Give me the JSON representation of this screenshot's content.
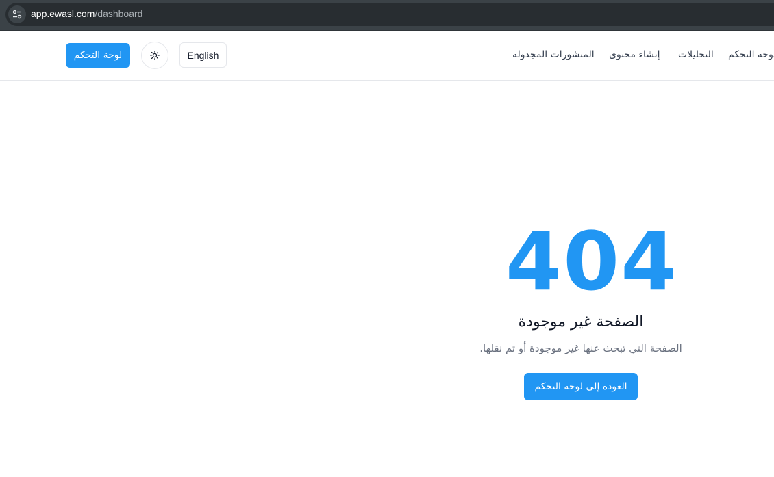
{
  "browser": {
    "url_domain": "app.ewasl.com",
    "url_path": "/dashboard",
    "site_info_icon": "tune-icon"
  },
  "header": {
    "primary_button": "لوحة التحكم",
    "theme_toggle_icon": "sun-icon",
    "language_button": "English",
    "nav": [
      {
        "label": "لوحة التحكم"
      },
      {
        "label": "التحليلات"
      },
      {
        "label": "إنشاء محتوى"
      },
      {
        "label": "المنشورات المجدولة"
      }
    ]
  },
  "main": {
    "code": "404",
    "title": "الصفحة غير موجودة",
    "description": "الصفحة التي تبحث عنها غير موجودة أو تم نقلها.",
    "back_button": "العودة إلى لوحة التحكم"
  },
  "colors": {
    "accent": "#2196f3",
    "browser_bar": "#3b4247",
    "url_pill": "#282d31"
  }
}
